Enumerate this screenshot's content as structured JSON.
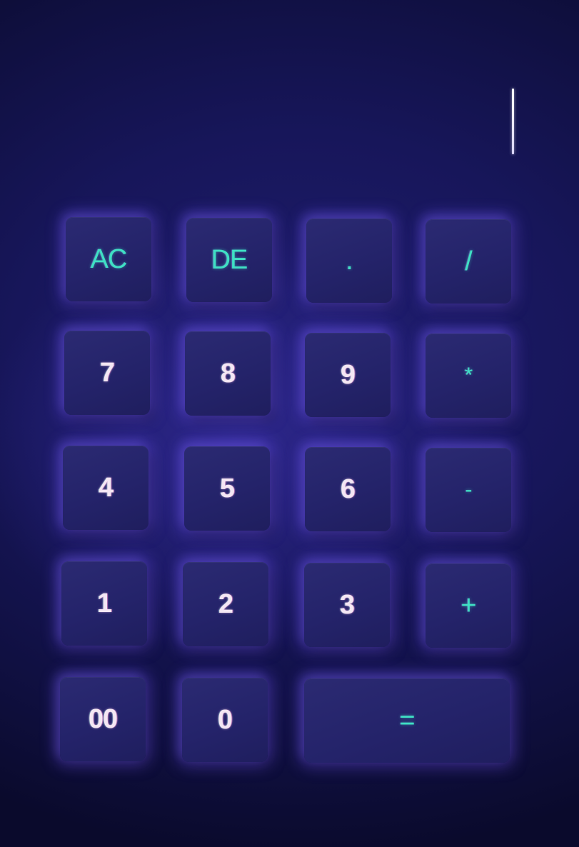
{
  "display": {
    "value": ""
  },
  "keys": {
    "ac": "AC",
    "de": "DE",
    "dot": ".",
    "divide": "/",
    "seven": "7",
    "eight": "8",
    "nine": "9",
    "multiply": "*",
    "four": "4",
    "five": "5",
    "six": "6",
    "minus": "-",
    "one": "1",
    "two": "2",
    "three": "3",
    "plus": "+",
    "double_zero": "00",
    "zero": "0",
    "equals": "="
  },
  "colors": {
    "background": "#17165a",
    "key": "#26256c",
    "glow": "#7a5aff",
    "operator_text": "#3fe0c4",
    "digit_text": "#f4e7f4"
  }
}
